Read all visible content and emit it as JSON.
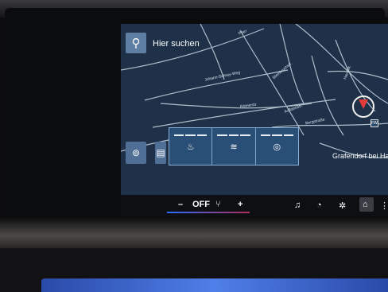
{
  "search": {
    "label": "Hier suchen",
    "icon": "search-icon"
  },
  "map": {
    "street_labels": [
      "Johann-Schray-Weg",
      "Römerstr.",
      "Steinbruchstr.",
      "Auffahrtstr.",
      "Bergstraße",
      "Hausstr.",
      "Pfarr"
    ],
    "place_label": "Grafendorf bei Har",
    "compass_icon": "compass-icon",
    "badge_text": "FW"
  },
  "seat_popup": {
    "options": [
      {
        "name": "seat-heating-icon",
        "glyph": "♨",
        "levels": 3
      },
      {
        "name": "seat-ventilation-icon",
        "glyph": "≋",
        "levels": 3
      },
      {
        "name": "steering-heating-icon",
        "glyph": "◎",
        "levels": 3
      }
    ]
  },
  "climate_bar": {
    "minus": "–",
    "status": "OFF",
    "seat_icon": "seat-icon",
    "plus": "+"
  },
  "nav_bar": {
    "items": [
      "music-icon",
      "speedometer-icon",
      "fan-icon",
      "home-icon"
    ]
  },
  "colors": {
    "accent_blue": "#2a6dff",
    "accent_red": "#b02a5a",
    "map_bg": "#1e3148",
    "popup_bg": "#2a4f76"
  }
}
